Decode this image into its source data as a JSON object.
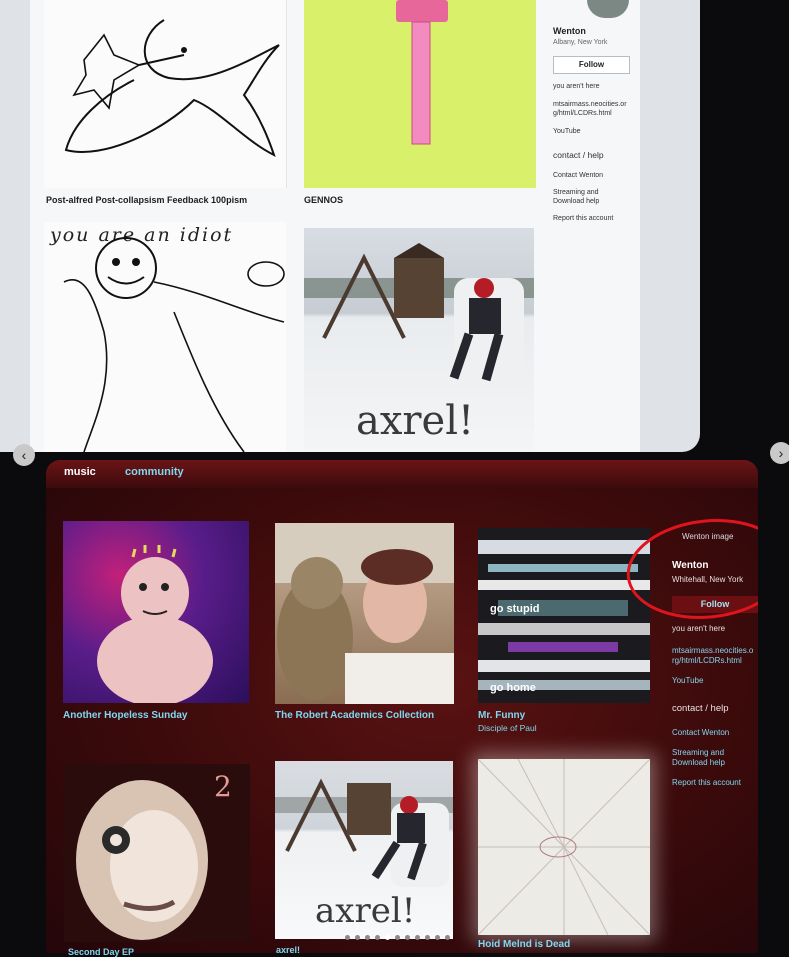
{
  "top": {
    "captions": [
      "Post-alfred Post-collapsism Feedback 100pism",
      "GENNOS"
    ],
    "idiot_text": "you are an idiot",
    "axrel_text": "axrel!",
    "profile": {
      "name": "Wenton",
      "location": "Albany, New York",
      "follow_label": "Follow",
      "not_here": "you aren't here",
      "link_url": "mtsairmass.neocities.org/html/LCDRs.html",
      "youtube": "YouTube",
      "contact_heading": "contact / help",
      "contact": "Contact Wenton",
      "streaming": "Streaming and Download help",
      "report": "Report this account"
    }
  },
  "bottom": {
    "nav": {
      "music": "music",
      "community": "community"
    },
    "albums": [
      {
        "title": "Another Hopeless Sunday",
        "artist": ""
      },
      {
        "title": "The Robert Academics Collection",
        "artist": ""
      },
      {
        "title": "Mr. Funny",
        "artist": "Disciple of Paul"
      },
      {
        "title": "",
        "artist": ""
      },
      {
        "title": "axrel!",
        "artist": ""
      },
      {
        "title": "Hoid Melnd is Dead",
        "artist": ""
      }
    ],
    "glitch_text": [
      "go stupid",
      "go home"
    ],
    "album4_number": "2",
    "axrel_text": "axrel!",
    "profile": {
      "image_alt": "Wenton image",
      "name": "Wenton",
      "location": "Whitehall, New York",
      "follow_label": "Follow",
      "not_here": "you aren't here",
      "link_url": "mtsairmass.neocities.org/html/LCDRs.html",
      "youtube": "YouTube",
      "contact_heading": "contact / help",
      "contact": "Contact Wenton",
      "streaming": "Streaming and Download help",
      "report": "Report this account"
    },
    "cut_off_titles": [
      "Second Day EP",
      "axrel!"
    ]
  },
  "carousel": {
    "slides": 11,
    "active_index": 4,
    "prev_icon": "chevron-left-icon",
    "next_icon": "chevron-right-icon"
  },
  "colors": {
    "link": "#7fd8f0",
    "dark_bg": "#3b0a0b",
    "annotation_circle": "#e0141c"
  }
}
